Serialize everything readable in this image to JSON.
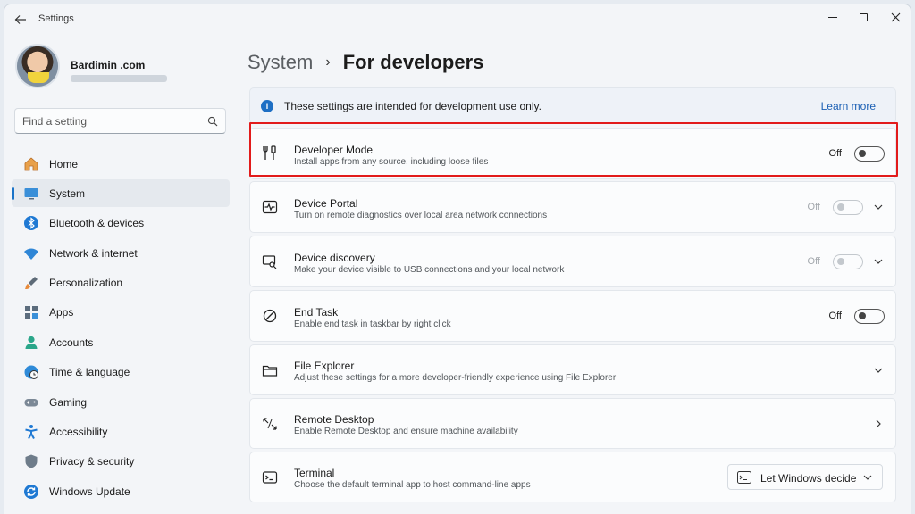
{
  "window": {
    "title": "Settings"
  },
  "profile": {
    "name": "Bardimin .com"
  },
  "search": {
    "placeholder": "Find a setting"
  },
  "sidebar": {
    "items": [
      {
        "label": "Home",
        "icon": "home-icon"
      },
      {
        "label": "System",
        "icon": "system-icon",
        "active": true
      },
      {
        "label": "Bluetooth & devices",
        "icon": "bluetooth-icon"
      },
      {
        "label": "Network & internet",
        "icon": "wifi-icon"
      },
      {
        "label": "Personalization",
        "icon": "brush-icon"
      },
      {
        "label": "Apps",
        "icon": "apps-icon"
      },
      {
        "label": "Accounts",
        "icon": "person-icon"
      },
      {
        "label": "Time & language",
        "icon": "globe-clock-icon"
      },
      {
        "label": "Gaming",
        "icon": "gamepad-icon"
      },
      {
        "label": "Accessibility",
        "icon": "accessibility-icon"
      },
      {
        "label": "Privacy & security",
        "icon": "shield-icon"
      },
      {
        "label": "Windows Update",
        "icon": "update-icon"
      }
    ]
  },
  "breadcrumb": {
    "parent": "System",
    "separator": "›",
    "current": "For developers"
  },
  "info": {
    "text": "These settings are intended for development use only.",
    "link": "Learn more"
  },
  "settings": [
    {
      "title": "Developer Mode",
      "desc": "Install apps from any source, including loose files",
      "toggle": "Off",
      "enabled": true,
      "highlighted": true
    },
    {
      "title": "Device Portal",
      "desc": "Turn on remote diagnostics over local area network connections",
      "toggle": "Off",
      "enabled": false,
      "expand": "down"
    },
    {
      "title": "Device discovery",
      "desc": "Make your device visible to USB connections and your local network",
      "toggle": "Off",
      "enabled": false,
      "expand": "down"
    },
    {
      "title": "End Task",
      "desc": "Enable end task in taskbar by right click",
      "toggle": "Off",
      "enabled": true
    },
    {
      "title": "File Explorer",
      "desc": "Adjust these settings for a more developer-friendly experience using File Explorer",
      "expand": "down"
    },
    {
      "title": "Remote Desktop",
      "desc": "Enable Remote Desktop and ensure machine availability",
      "expand": "right"
    },
    {
      "title": "Terminal",
      "desc": "Choose the default terminal app to host command-line apps",
      "dropdown": "Let Windows decide"
    }
  ],
  "colors": {
    "accent": "#1a73c8",
    "highlight": "#e21b1b",
    "link": "#1a5fb4"
  }
}
